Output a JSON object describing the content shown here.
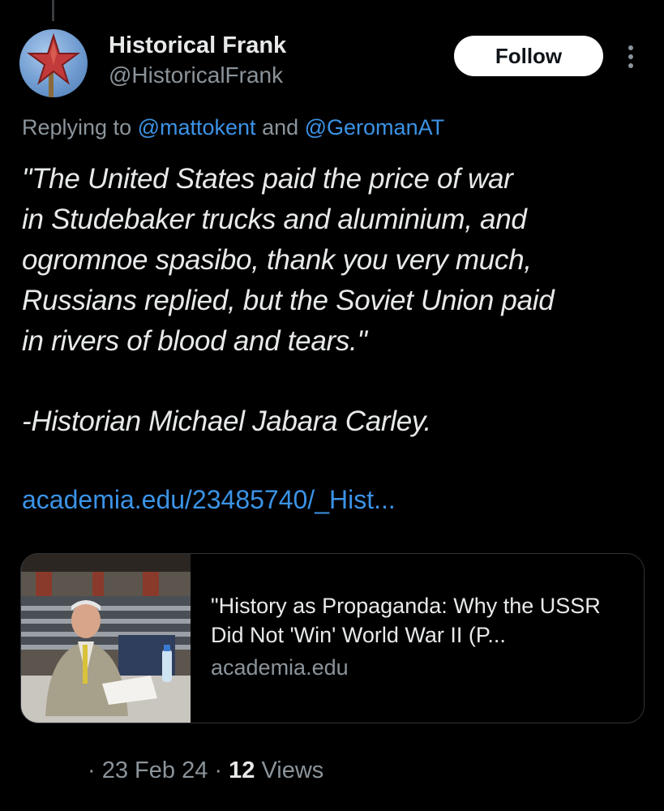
{
  "author": {
    "display_name": "Historical Frank",
    "handle": "@HistoricalFrank",
    "avatar_icon": "red-star-icon"
  },
  "follow_button": {
    "label": "Follow"
  },
  "more_menu": {
    "icon": "more-vertical-icon"
  },
  "reply": {
    "prefix": "Replying to ",
    "mention_1": "@mattokent",
    "joiner": " and ",
    "mention_2": "@GeromanAT"
  },
  "tweet": {
    "body": "\"The United States paid the price of war\nin Studebaker trucks and aluminium, and\nogromnoe spasibo, thank you very much,\nRussians replied, but the Soviet Union paid\nin rivers of blood and tears.\"",
    "attribution": "-Historian Michael Jabara Carley.",
    "link_text": "academia.edu/23485740/_Hist..."
  },
  "link_card": {
    "title": "\"History as Propaganda: Why the USSR Did Not 'Win' World War II (P...",
    "domain": "academia.edu"
  },
  "meta": {
    "separator_1": "·",
    "date": "23 Feb 24",
    "separator_2": "·",
    "views_count": "12",
    "views_label": "Views"
  },
  "colors": {
    "background": "#000000",
    "text": "#e7e9ea",
    "secondary": "#8b949b",
    "link": "#3b93e6",
    "follow_bg": "#ffffff"
  }
}
